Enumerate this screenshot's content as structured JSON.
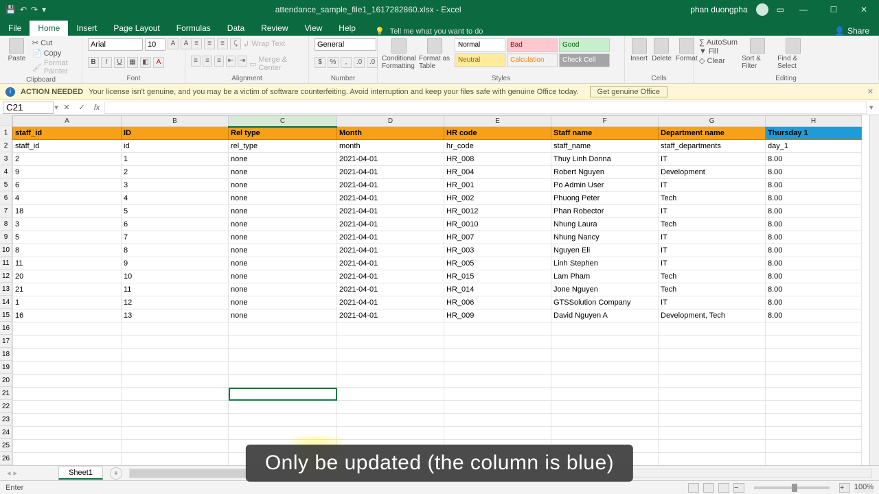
{
  "title": {
    "document": "attendance_sample_file1_1617282860.xlsx - Excel",
    "user": "phan duongpha"
  },
  "tabs": {
    "file": "File",
    "home": "Home",
    "insert": "Insert",
    "page": "Page Layout",
    "formulas": "Formulas",
    "data": "Data",
    "review": "Review",
    "view": "View",
    "help": "Help",
    "tell": "Tell me what you want to do",
    "share": "Share"
  },
  "ribbon": {
    "clipboard": {
      "label": "Clipboard",
      "paste": "Paste",
      "cut": "Cut",
      "copy": "Copy",
      "painter": "Format Painter"
    },
    "font": {
      "label": "Font",
      "name": "Arial",
      "size": "10"
    },
    "align": {
      "label": "Alignment",
      "wrap": "Wrap Text",
      "merge": "Merge & Center"
    },
    "number": {
      "label": "Number",
      "format": "General"
    },
    "styles": {
      "label": "Styles",
      "cond": "Conditional Formatting",
      "table": "Format as Table",
      "normal": "Normal",
      "bad": "Bad",
      "good": "Good",
      "neutral": "Neutral",
      "calc": "Calculation",
      "check": "Check Cell"
    },
    "cells": {
      "label": "Cells",
      "insert": "Insert",
      "delete": "Delete",
      "format": "Format"
    },
    "editing": {
      "label": "Editing",
      "sum": "AutoSum",
      "fill": "Fill",
      "clear": "Clear",
      "sort": "Sort & Filter",
      "find": "Find & Select"
    }
  },
  "warn": {
    "tag": "ACTION NEEDED",
    "msg": "Your license isn't genuine, and you may be a victim of software counterfeiting. Avoid interruption and keep your files safe with genuine Office today.",
    "btn": "Get genuine Office"
  },
  "fbar": {
    "cell": "C21",
    "fx": ""
  },
  "columns": [
    {
      "letter": "A",
      "width": 158,
      "header": "staff_id"
    },
    {
      "letter": "B",
      "width": 156,
      "header": "ID"
    },
    {
      "letter": "C",
      "width": 158,
      "header": "Rel type",
      "selected": true
    },
    {
      "letter": "D",
      "width": 156,
      "header": "Month"
    },
    {
      "letter": "E",
      "width": 156,
      "header": "HR code"
    },
    {
      "letter": "F",
      "width": 156,
      "header": "Staff name"
    },
    {
      "letter": "G",
      "width": 156,
      "header": "Department name"
    },
    {
      "letter": "H",
      "width": 140,
      "header": "Thursday 1",
      "blue": true
    }
  ],
  "rows": [
    [
      "staff_id",
      "id",
      "rel_type",
      "month",
      "hr_code",
      "staff_name",
      "staff_departments",
      "day_1"
    ],
    [
      "2",
      "1",
      "none",
      "2021-04-01",
      "HR_008",
      "Thuy Linh  Donna",
      "IT",
      "8.00"
    ],
    [
      "9",
      "2",
      "none",
      "2021-04-01",
      "HR_004",
      "Robert Nguyen",
      "Development",
      "8.00"
    ],
    [
      "6",
      "3",
      "none",
      "2021-04-01",
      "HR_001",
      "Po Admin User",
      "IT",
      "8.00"
    ],
    [
      "4",
      "4",
      "none",
      "2021-04-01",
      "HR_002",
      "Phuong Peter",
      "Tech",
      "8.00"
    ],
    [
      "18",
      "5",
      "none",
      "2021-04-01",
      "HR_0012",
      "Phan Robector",
      "IT",
      "8.00"
    ],
    [
      "3",
      "6",
      "none",
      "2021-04-01",
      "HR_0010",
      "Nhung Laura",
      "Tech",
      "8.00"
    ],
    [
      "5",
      "7",
      "none",
      "2021-04-01",
      "HR_007",
      "Nhung Nancy",
      "IT",
      "8.00"
    ],
    [
      "8",
      "8",
      "none",
      "2021-04-01",
      "HR_003",
      "Nguyen Eli",
      "IT",
      "8.00"
    ],
    [
      "11",
      "9",
      "none",
      "2021-04-01",
      "HR_005",
      "Linh Stephen",
      "IT",
      "8.00"
    ],
    [
      "20",
      "10",
      "none",
      "2021-04-01",
      "HR_015",
      "Lam Pham",
      "Tech",
      "8.00"
    ],
    [
      "21",
      "11",
      "none",
      "2021-04-01",
      "HR_014",
      "Jone  Nguyen",
      "Tech",
      "8.00"
    ],
    [
      "1",
      "12",
      "none",
      "2021-04-01",
      "HR_006",
      "GTSSolution Company",
      "IT",
      "8.00"
    ],
    [
      "16",
      "13",
      "none",
      "2021-04-01",
      "HR_009",
      "David Nguyen A",
      "Development, Tech",
      "8.00"
    ]
  ],
  "empty_rows": 13,
  "selected": {
    "row": 21,
    "col": 2
  },
  "sheet": {
    "name": "Sheet1"
  },
  "status": {
    "mode": "Enter",
    "zoom": "100%"
  },
  "caption": "Only be updated (the column is blue)"
}
